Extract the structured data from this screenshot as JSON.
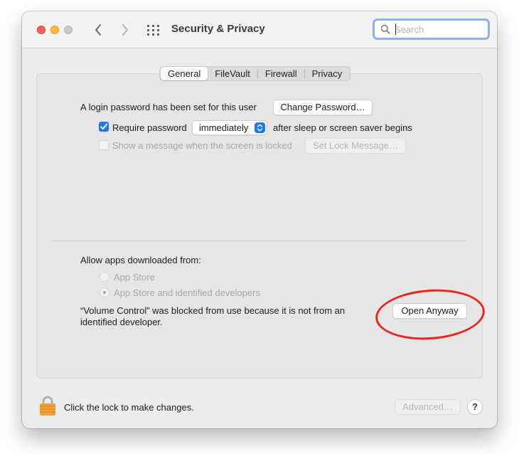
{
  "window": {
    "title": "Security & Privacy",
    "search_placeholder": "Search"
  },
  "tabs": [
    {
      "label": "General",
      "active": true
    },
    {
      "label": "FileVault",
      "active": false
    },
    {
      "label": "Firewall",
      "active": false
    },
    {
      "label": "Privacy",
      "active": false
    }
  ],
  "general": {
    "login_text": "A login password has been set for this user",
    "change_password_label": "Change Password…",
    "require_password_label": "Require password",
    "require_password_checked": true,
    "require_password_value": "immediately",
    "after_sleep_text": "after sleep or screen saver begins",
    "show_message_label": "Show a message when the screen is locked",
    "show_message_checked": false,
    "set_lock_message_label": "Set Lock Message…"
  },
  "apps": {
    "heading": "Allow apps downloaded from:",
    "options": [
      {
        "label": "App Store",
        "selected": false
      },
      {
        "label": "App Store and identified developers",
        "selected": true
      }
    ],
    "blocked_message": "“Volume Control” was blocked from use because it is not from an identified developer.",
    "open_anyway_label": "Open Anyway"
  },
  "footer": {
    "lock_text": "Click the lock to make changes.",
    "advanced_label": "Advanced…",
    "help_label": "?"
  },
  "colors": {
    "accent": "#1d78f3",
    "search_focus": "#8db3ea",
    "highlight_circle": "#e8281e",
    "lock": "#f0a236"
  },
  "icons": [
    "close-button",
    "minimize-button",
    "zoom-button",
    "chevron-left-icon",
    "chevron-right-icon",
    "grid-icon",
    "search-icon",
    "checkmark-icon",
    "stepper-icon",
    "lock-icon"
  ]
}
